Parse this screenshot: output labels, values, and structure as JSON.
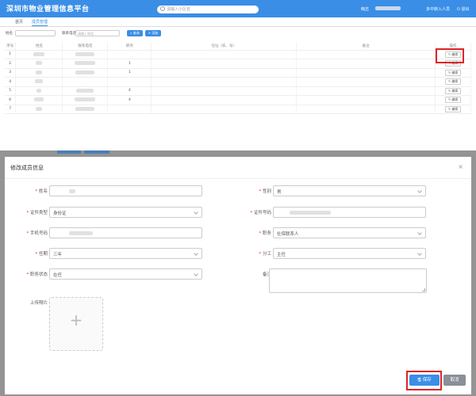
{
  "app": {
    "title": "深圳市物业管理信息平台",
    "search_placeholder": "请输入小区名",
    "user_label": "韩志",
    "switch_label": "多中转入人员",
    "logout_label": "退出"
  },
  "tabs": [
    {
      "label": "首页",
      "active": false
    },
    {
      "label": "成员管理",
      "active": true
    }
  ],
  "filter": {
    "name_label": "姓名",
    "phone_label": "联系电话",
    "phone_placeholder": "请输入电话",
    "query_label": "查询",
    "add_label": "添加"
  },
  "table": {
    "headers": [
      "序号",
      "姓名",
      "联系电话",
      "职务",
      "任址（栋、号）",
      "备注",
      "操作"
    ],
    "rows": [
      {
        "no": "1",
        "position": "",
        "edit": "编辑"
      },
      {
        "no": "2",
        "position": "1",
        "edit": "编辑"
      },
      {
        "no": "3",
        "position": "1",
        "edit": "编辑"
      },
      {
        "no": "4",
        "position": "",
        "edit": "编辑"
      },
      {
        "no": "5",
        "position": "4",
        "edit": "编辑"
      },
      {
        "no": "6",
        "position": "4",
        "edit": "编辑"
      },
      {
        "no": "7",
        "position": "",
        "edit": "编辑"
      }
    ]
  },
  "modal": {
    "title": "修改成员信息",
    "close": "×",
    "fields": {
      "name_label": "姓名",
      "gender_label": "性别",
      "gender_value": "男",
      "idtype_label": "证件类型",
      "idtype_value": "身份证",
      "idno_label": "证件号码",
      "phone_label": "手机号码",
      "duty_label": "职务",
      "duty_value": "社保联系人",
      "term_label": "任期",
      "term_value": "三年",
      "division_label": "分工",
      "division_value": "主任",
      "status_label": "职务状态",
      "status_value": "在任",
      "remark_label": "备注",
      "photo_label": "上传照片"
    },
    "save_label": "保存",
    "cancel_label": "取消"
  },
  "colors": {
    "primary": "#3a8ee6",
    "highlight": "#e02424",
    "cancel": "#8a8f99"
  }
}
